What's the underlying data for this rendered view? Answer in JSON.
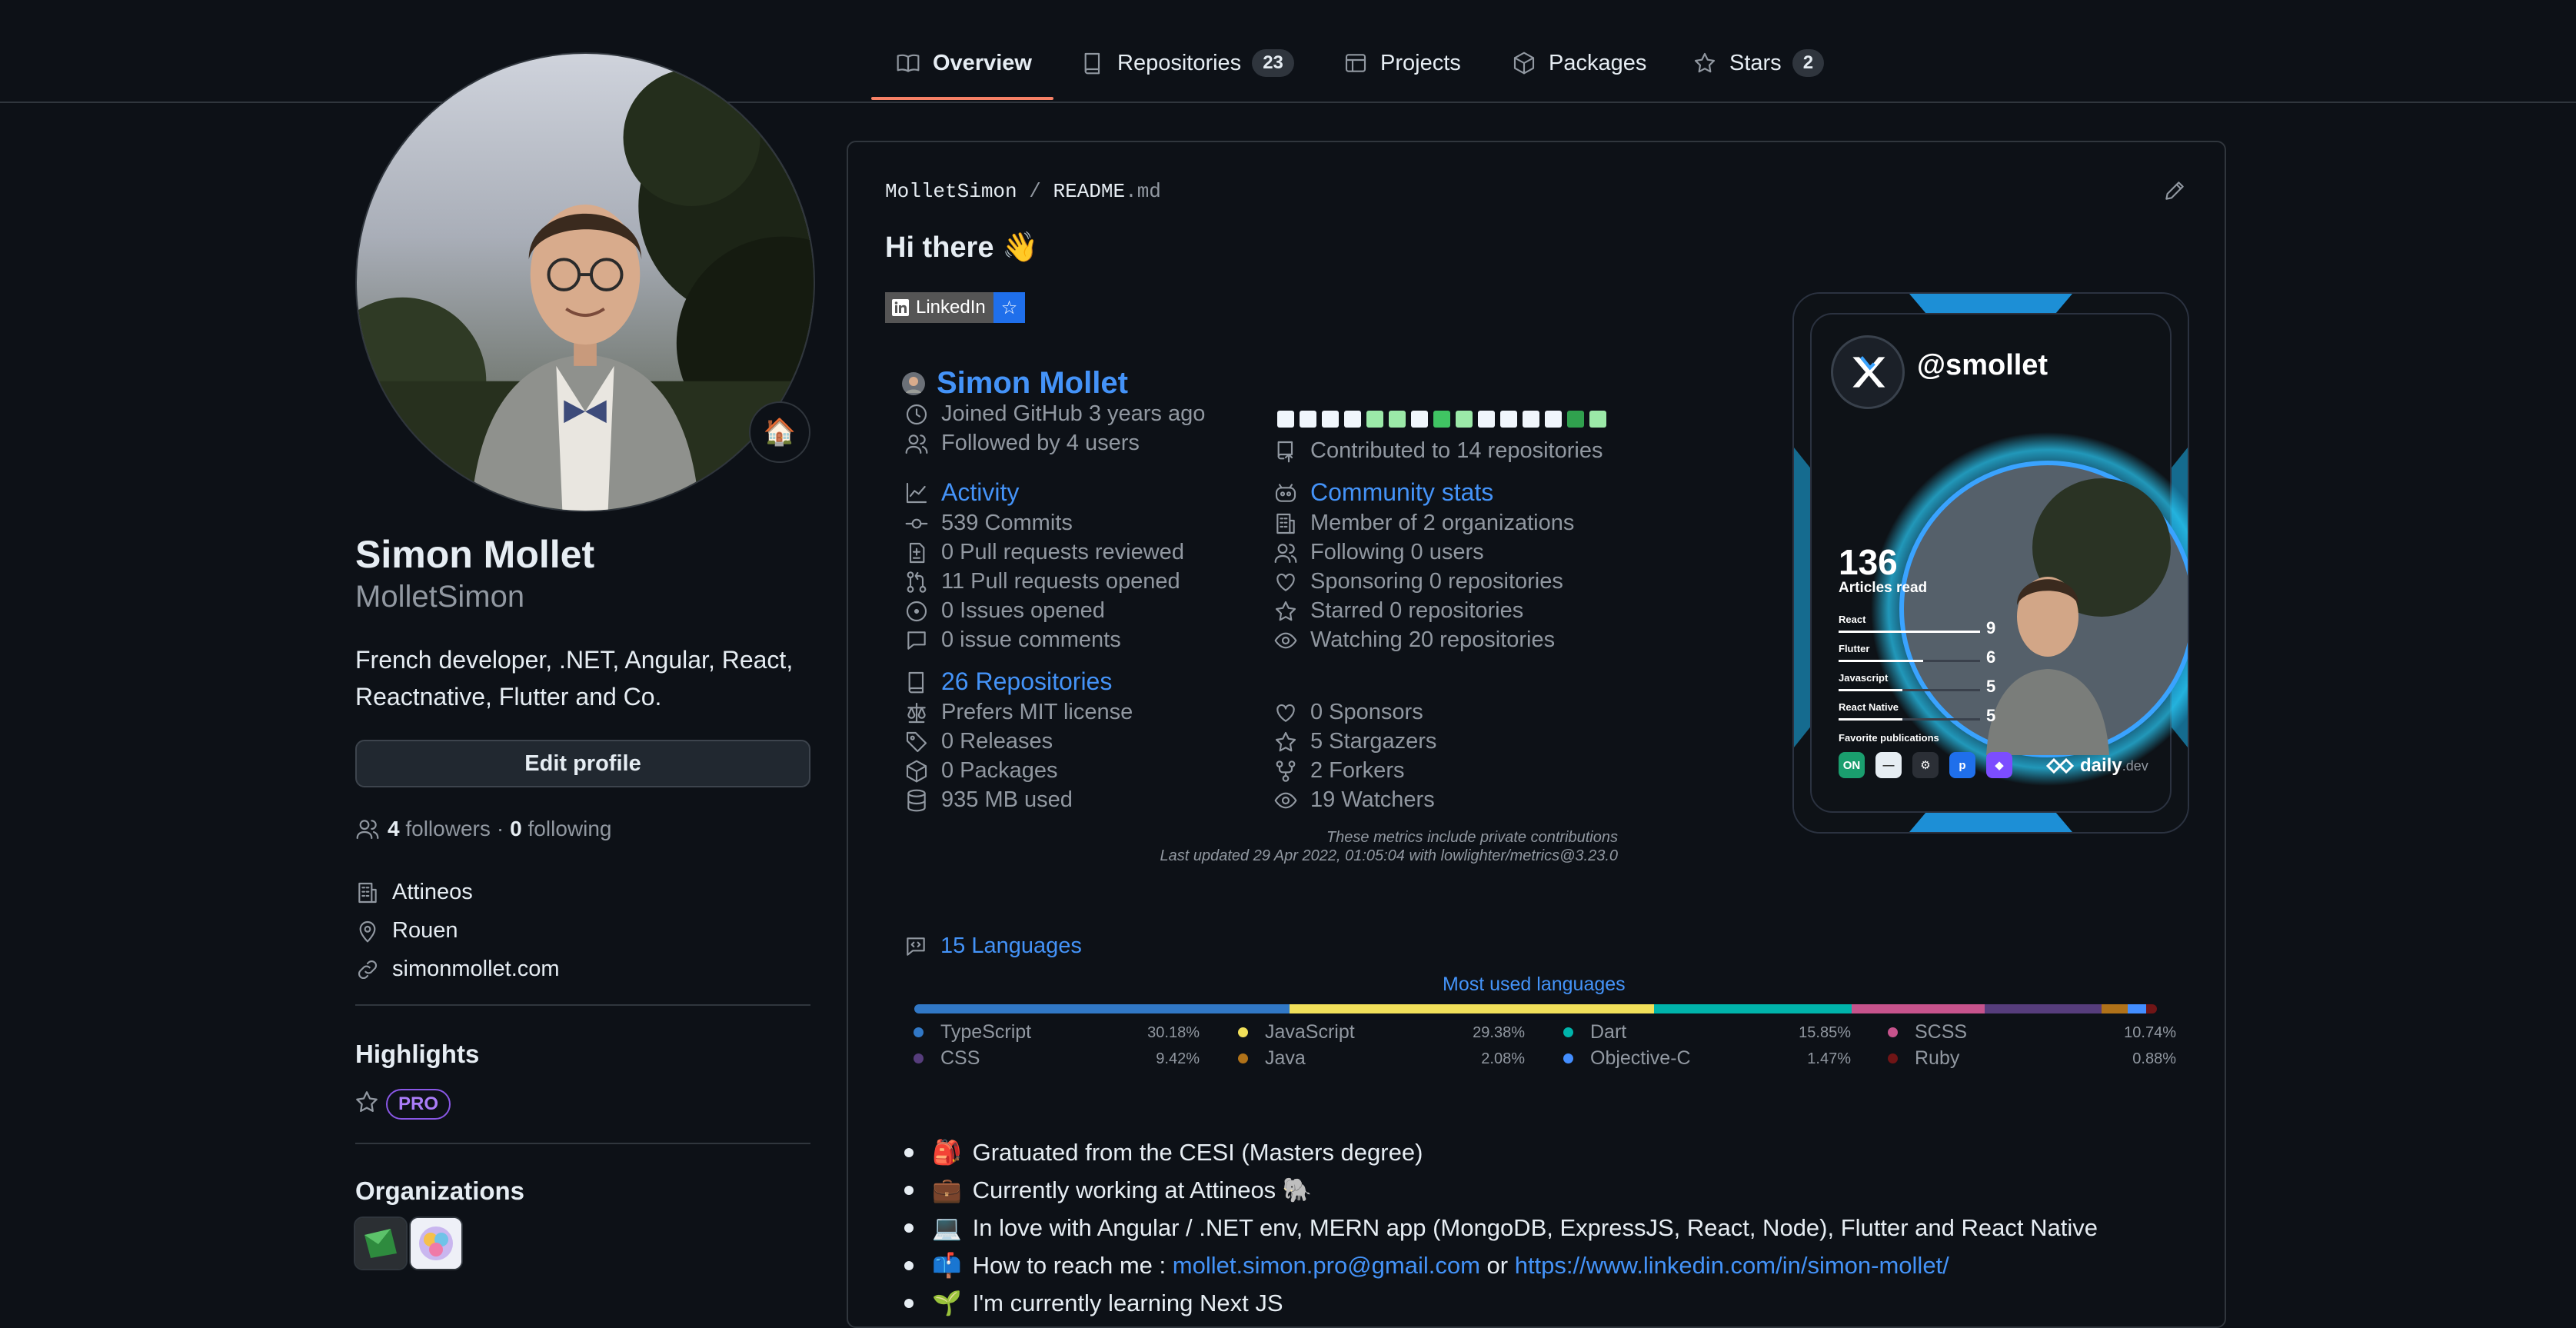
{
  "nav": {
    "tabs": [
      {
        "label": "Overview"
      },
      {
        "label": "Repositories",
        "count": "23"
      },
      {
        "label": "Projects"
      },
      {
        "label": "Packages"
      },
      {
        "label": "Stars",
        "count": "2"
      }
    ]
  },
  "profile": {
    "status_emoji": "🏠",
    "name": "Simon Mollet",
    "login": "MolletSimon",
    "bio": "French developer, .NET, Angular, React, Reactnative, Flutter and Co.",
    "edit_label": "Edit profile",
    "followers_count": "4",
    "followers_label": "followers",
    "following_count": "0",
    "following_label": "following",
    "company": "Attineos",
    "location": "Rouen",
    "website": "simonmollet.com",
    "highlights_title": "Highlights",
    "pro_label": "PRO",
    "orgs_title": "Organizations"
  },
  "readme": {
    "path_user": "MolletSimon",
    "path_sep": "/",
    "path_file": "README",
    "path_ext": ".md",
    "greeting": "Hi there 👋",
    "linkedin_label": "LinkedIn",
    "linkedin_star": "☆"
  },
  "metrics": {
    "name": "Simon Mollet",
    "joined": "Joined GitHub 3 years ago",
    "followed_by": "Followed by 4 users",
    "contributed": "Contributed to 14 repositories",
    "activity_title": "Activity",
    "commits": "539 Commits",
    "pr_reviewed": "0 Pull requests reviewed",
    "pr_opened": "11 Pull requests opened",
    "issues_opened": "0 Issues opened",
    "issue_comments": "0 issue comments",
    "community_title": "Community stats",
    "member_of": "Member of 2 organizations",
    "following": "Following 0 users",
    "sponsoring": "Sponsoring 0 repositories",
    "starred": "Starred 0 repositories",
    "watching": "Watching 20 repositories",
    "repos_title": "26 Repositories",
    "license": "Prefers MIT license",
    "releases": "0 Releases",
    "packages": "0 Packages",
    "disk": "935 MB used",
    "sponsors": "0 Sponsors",
    "stargazers": "5 Stargazers",
    "forkers": "2 Forkers",
    "watchers": "19 Watchers",
    "footnote1": "These metrics include private contributions",
    "footnote2": "Last updated 29 Apr 2022, 01:05:04 with lowlighter/metrics@3.23.0",
    "calendar": [
      "#f0f6fc",
      "#f0f6fc",
      "#f0f6fc",
      "#f0f6fc",
      "#9be9a8",
      "#9be9a8",
      "#f0f6fc",
      "#40c463",
      "#9be9a8",
      "#f0f6fc",
      "#f0f6fc",
      "#f0f6fc",
      "#f0f6fc",
      "#30a14e",
      "#9be9a8"
    ]
  },
  "devcard": {
    "handle": "@smollet",
    "articles_count": "136",
    "articles_label": "Articles read",
    "tags": [
      {
        "name": "React",
        "count": "9",
        "fill": 1.0
      },
      {
        "name": "Flutter",
        "count": "6",
        "fill": 0.6
      },
      {
        "name": "Javascript",
        "count": "5",
        "fill": 0.45
      },
      {
        "name": "React Native",
        "count": "5",
        "fill": 0.45
      }
    ],
    "favorites_label": "Favorite publications",
    "publications": [
      "ON",
      "—",
      "⚙",
      "p",
      "◆"
    ],
    "brand": "daily",
    "brand_suffix": ".dev"
  },
  "languages": {
    "title": "15 Languages",
    "subtitle": "Most used languages",
    "items": [
      {
        "name": "TypeScript",
        "pct": "30.18%",
        "value": 30.18,
        "color": "#3178c6"
      },
      {
        "name": "JavaScript",
        "pct": "29.38%",
        "value": 29.38,
        "color": "#f1e05a"
      },
      {
        "name": "Dart",
        "pct": "15.85%",
        "value": 15.85,
        "color": "#00b4ab"
      },
      {
        "name": "SCSS",
        "pct": "10.74%",
        "value": 10.74,
        "color": "#c6538c"
      },
      {
        "name": "CSS",
        "pct": "9.42%",
        "value": 9.42,
        "color": "#563d7c"
      },
      {
        "name": "Java",
        "pct": "2.08%",
        "value": 2.08,
        "color": "#b07219"
      },
      {
        "name": "Objective-C",
        "pct": "1.47%",
        "value": 1.47,
        "color": "#438eff"
      },
      {
        "name": "Ruby",
        "pct": "0.88%",
        "value": 0.88,
        "color": "#701516"
      }
    ]
  },
  "bullets": {
    "b1_emoji": "🎒",
    "b1": "Gratuated from the CESI (Masters degree)",
    "b2_emoji": "💼",
    "b2": "Currently working at Attineos 🐘",
    "b3_emoji": "💻",
    "b3": "In love with Angular / .NET env, MERN app (MongoDB, ExpressJS, React, Node), Flutter and React Native",
    "b4_emoji": "📫",
    "b4": "How to reach me : ",
    "b4_email": "mollet.simon.pro@gmail.com",
    "b4_or": " or ",
    "b4_link": "https://www.linkedin.com/in/simon-mollet/",
    "b5_emoji": "🌱",
    "b5": "I'm currently learning Next JS"
  }
}
